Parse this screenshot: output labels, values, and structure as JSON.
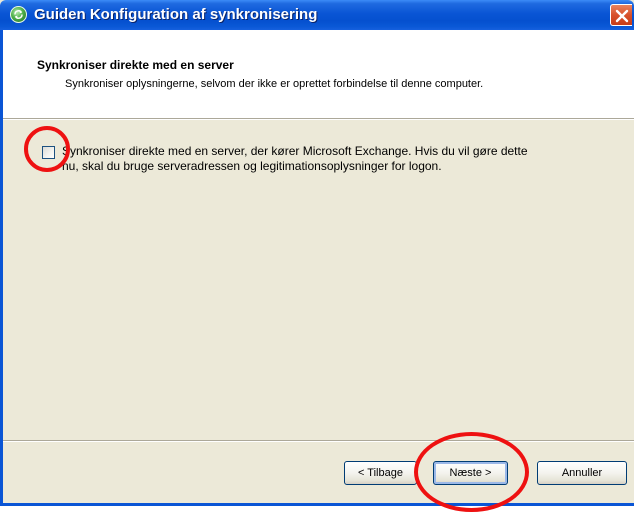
{
  "window": {
    "title": "Guiden Konfiguration af synkronisering"
  },
  "header": {
    "title": "Synkroniser direkte med en server",
    "subtitle": "Synkroniser oplysningerne, selvom der ikke er oprettet forbindelse til denne computer."
  },
  "option": {
    "label": "Synkroniser direkte med en server, der kører Microsoft Exchange. Hvis du vil gøre dette nu, skal du bruge serveradressen og legitimationsoplysninger for logon.",
    "checked": false
  },
  "buttons": {
    "back": "< Tilbage",
    "next": "Næste >",
    "cancel": "Annuller"
  },
  "icons": {
    "title_icon": "sync-icon",
    "close_icon": "close-icon"
  },
  "colors": {
    "titlebar": "#0a55d5",
    "dialog_bg": "#ece9d8",
    "annotation": "#ee1111",
    "close_button": "#d8512b"
  }
}
